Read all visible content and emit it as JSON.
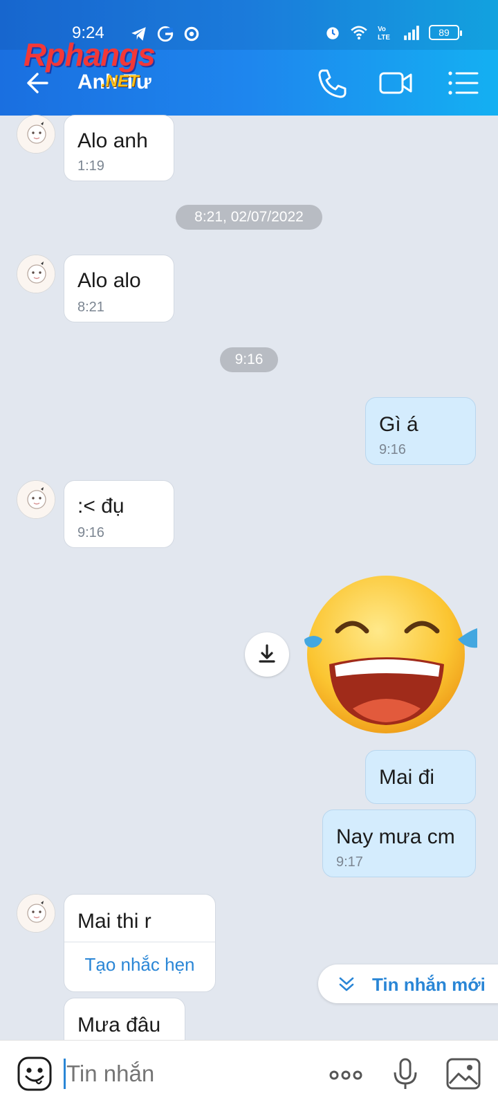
{
  "status_bar": {
    "time": "9:24",
    "battery": "89",
    "left_icons": [
      "telegram-icon",
      "g-icon",
      "sync-icon"
    ],
    "right_icons": [
      "alarm-icon",
      "wifi-icon",
      "volte-icon",
      "signal-icon",
      "battery-icon"
    ]
  },
  "header": {
    "contact_name": "Anh Tư",
    "watermark": "Rphangs",
    "watermark_sub": ".NET",
    "icons": [
      "back-arrow-icon",
      "phone-icon",
      "video-call-icon",
      "list-menu-icon"
    ]
  },
  "messages": [
    {
      "direction": "in",
      "text": "Alo anh",
      "time": "1:19"
    },
    {
      "type": "date",
      "text": "8:21, 02/07/2022"
    },
    {
      "direction": "in",
      "text": "Alo alo",
      "time": "8:21"
    },
    {
      "type": "date",
      "text": "9:16"
    },
    {
      "direction": "out",
      "text": "Gì á",
      "time": "9:16"
    },
    {
      "direction": "in",
      "text": ":< đụ",
      "time": "9:16"
    },
    {
      "direction": "out",
      "type": "sticker",
      "sticker": "laughing-tears-emoji"
    },
    {
      "direction": "out",
      "text": "Mai đi"
    },
    {
      "direction": "out",
      "text": "Nay mưa cm",
      "time": "9:17"
    },
    {
      "direction": "in",
      "text": "Mai thi r",
      "action": "Tạo nhắc hẹn"
    },
    {
      "direction": "in",
      "text": "Mưa đâu"
    }
  ],
  "new_message_button": {
    "label": "Tin nhắn mới"
  },
  "input": {
    "placeholder": "Tin nhắn"
  },
  "colors": {
    "header_start": "#1a6fe0",
    "header_end": "#14b0f2",
    "chat_bg": "#e2e7ef",
    "outgoing_bubble": "#d4ecfd",
    "incoming_bubble": "#ffffff",
    "accent": "#2a86d6"
  }
}
